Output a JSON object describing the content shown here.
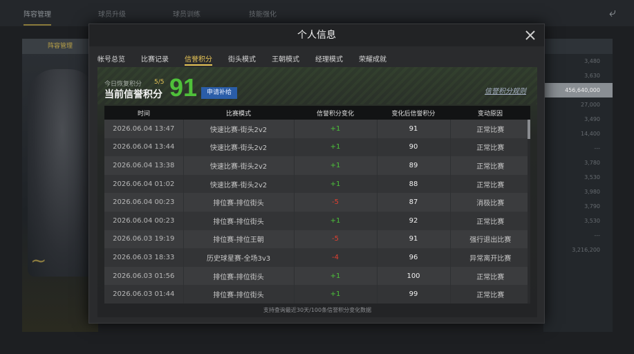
{
  "background": {
    "tabs": [
      "阵容管理",
      "球员升级",
      "球员训练",
      "技能强化"
    ],
    "right_values": [
      "3,480",
      "3,630",
      "456,640,000",
      "27,000",
      "3,490",
      "14,400",
      "---",
      "3,780",
      "3,530",
      "3,980",
      "3,790",
      "3,530",
      "---",
      "3,216,200"
    ]
  },
  "modal": {
    "title": "个人信息",
    "tabs": [
      {
        "label": "帐号总览",
        "active": false
      },
      {
        "label": "比赛记录",
        "active": false
      },
      {
        "label": "信誉积分",
        "active": true
      },
      {
        "label": "街头模式",
        "active": false
      },
      {
        "label": "王朝模式",
        "active": false
      },
      {
        "label": "经理模式",
        "active": false
      },
      {
        "label": "荣耀成就",
        "active": false
      }
    ],
    "recover_label": "今日恢复积分",
    "recover_value": "5/5",
    "current_label": "当前信誉积分",
    "current_value": "91",
    "apply_button": "申请补给",
    "rules_link": "信誉积分规则",
    "columns": [
      "时间",
      "比赛模式",
      "信誉积分变化",
      "变化后信誉积分",
      "变动原因"
    ],
    "rows": [
      {
        "time": "2026.06.04  13:47",
        "mode": "快速比赛-街头2v2",
        "change": "+1",
        "after": "91",
        "reason": "正常比赛"
      },
      {
        "time": "2026.06.04  13:44",
        "mode": "快速比赛-街头2v2",
        "change": "+1",
        "after": "90",
        "reason": "正常比赛"
      },
      {
        "time": "2026.06.04  13:38",
        "mode": "快速比赛-街头2v2",
        "change": "+1",
        "after": "89",
        "reason": "正常比赛"
      },
      {
        "time": "2026.06.04  01:02",
        "mode": "快速比赛-街头2v2",
        "change": "+1",
        "after": "88",
        "reason": "正常比赛"
      },
      {
        "time": "2026.06.04  00:23",
        "mode": "排位赛-排位街头",
        "change": "-5",
        "after": "87",
        "reason": "消极比赛"
      },
      {
        "time": "2026.06.04  00:23",
        "mode": "排位赛-排位街头",
        "change": "+1",
        "after": "92",
        "reason": "正常比赛"
      },
      {
        "time": "2026.06.03  19:19",
        "mode": "排位赛-排位王朝",
        "change": "-5",
        "after": "91",
        "reason": "强行退出比赛"
      },
      {
        "time": "2026.06.03  18:33",
        "mode": "历史球星赛-全场3v3",
        "change": "-4",
        "after": "96",
        "reason": "异常离开比赛"
      },
      {
        "time": "2026.06.03  01:56",
        "mode": "排位赛-排位街头",
        "change": "+1",
        "after": "100",
        "reason": "正常比赛"
      },
      {
        "time": "2026.06.03  01:44",
        "mode": "排位赛-排位街头",
        "change": "+1",
        "after": "99",
        "reason": "正常比赛"
      }
    ],
    "footer_note": "支持查询最近30天/100条信誉积分变化数据",
    "colors": {
      "positive": "#4cc23a",
      "negative": "#e04030",
      "accent": "#e8c556",
      "score": "#4fc03a"
    }
  }
}
